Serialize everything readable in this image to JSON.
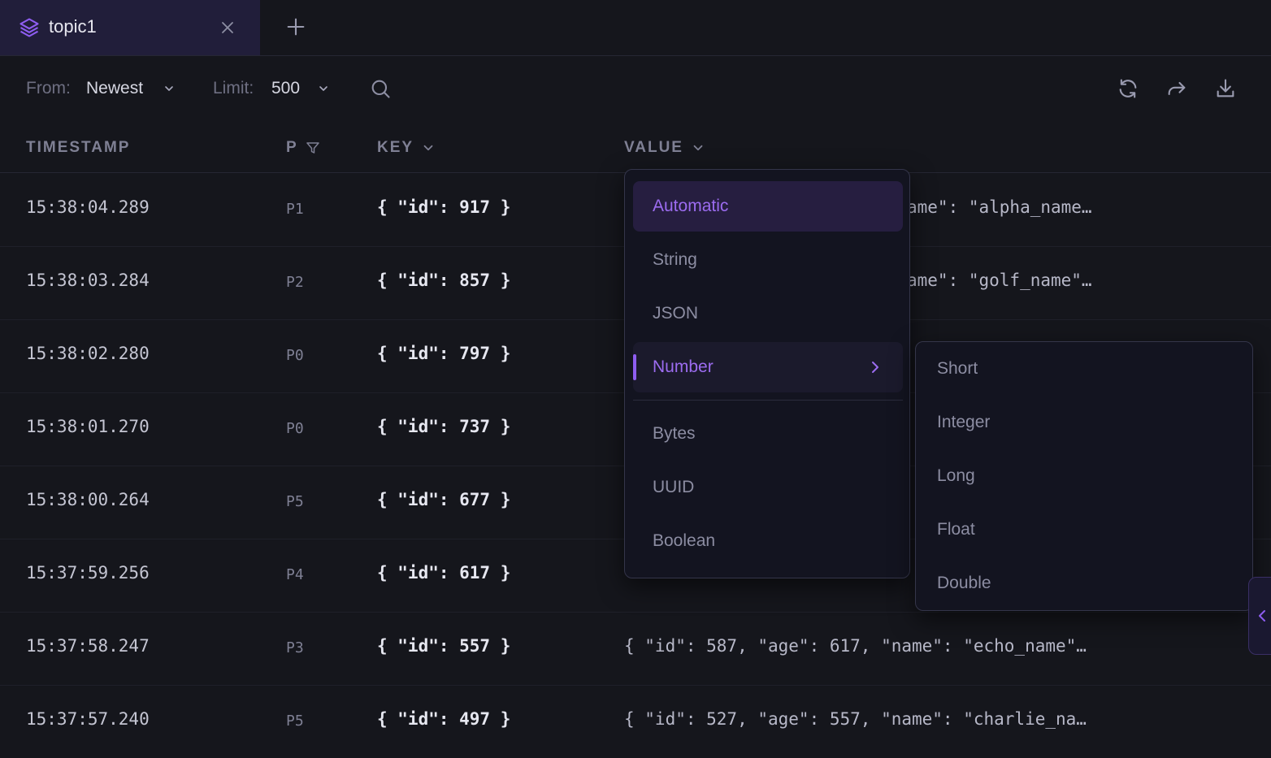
{
  "tab": {
    "title": "topic1"
  },
  "toolbar": {
    "from_label": "From:",
    "from_value": "Newest",
    "limit_label": "Limit:",
    "limit_value": "500"
  },
  "columns": {
    "timestamp": "TIMESTAMP",
    "partition": "P",
    "key": "KEY",
    "value": "VALUE"
  },
  "rows": [
    {
      "timestamp": "15:38:04.289",
      "partition": "P1",
      "key": "{ \"id\": 917 }",
      "value_visible": "ame\": \"alpha_name…"
    },
    {
      "timestamp": "15:38:03.284",
      "partition": "P2",
      "key": "{ \"id\": 857 }",
      "value_visible": "ame\": \"golf_name\"…"
    },
    {
      "timestamp": "15:38:02.280",
      "partition": "P0",
      "key": "{ \"id\": 797 }",
      "value_visible": ""
    },
    {
      "timestamp": "15:38:01.270",
      "partition": "P0",
      "key": "{ \"id\": 737 }",
      "value_visible": ""
    },
    {
      "timestamp": "15:38:00.264",
      "partition": "P5",
      "key": "{ \"id\": 677 }",
      "value_visible": ""
    },
    {
      "timestamp": "15:37:59.256",
      "partition": "P4",
      "key": "{ \"id\": 617 }",
      "value_visible": ""
    },
    {
      "timestamp": "15:37:58.247",
      "partition": "P3",
      "key": "{ \"id\": 557 }",
      "value_visible": "{ \"id\": 587, \"age\": 617, \"name\": \"echo_name\"…"
    },
    {
      "timestamp": "15:37:57.240",
      "partition": "P5",
      "key": "{ \"id\": 497 }",
      "value_visible": "{ \"id\": 527, \"age\": 557, \"name\": \"charlie_na…"
    }
  ],
  "value_format_menu": {
    "items": [
      "Automatic",
      "String",
      "JSON",
      "Number",
      "Bytes",
      "UUID",
      "Boolean"
    ],
    "selected": "Automatic",
    "expanded": "Number"
  },
  "number_submenu": {
    "items": [
      "Short",
      "Integer",
      "Long",
      "Float",
      "Double"
    ]
  },
  "colors": {
    "background": "#15161c",
    "accent": "#8e5df0",
    "tab_active_bg": "#211e3a"
  }
}
